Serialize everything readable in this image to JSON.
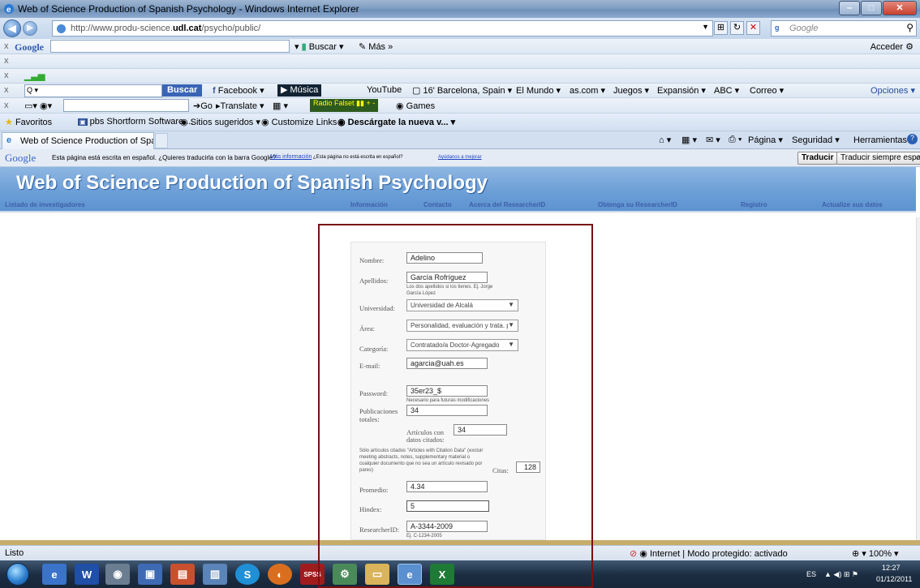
{
  "window": {
    "title": "Web of Science Production of Spanish Psychology - Windows Internet Explorer"
  },
  "address": {
    "url_prefix": "http://www.produ-science.",
    "url_domain": "udl.cat",
    "url_path": "/psycho/public/",
    "search_placeholder": "Google"
  },
  "google_toolbar": {
    "search_btn": "Buscar",
    "mas": "Más",
    "acceder": "Acceder"
  },
  "toolbar2": {
    "buscar": "Buscar",
    "items": [
      "Facebook",
      "Música",
      "YouTube",
      "16' Barcelona, Spain",
      "El Mundo",
      "as.com",
      "Juegos",
      "Expansión",
      "ABC",
      "Correo"
    ],
    "opciones": "Opciones"
  },
  "toolbar3": {
    "go": "Go",
    "translate": "Translate",
    "radio": "Radio Falset",
    "games": "Games"
  },
  "favorites": {
    "label": "Favoritos",
    "items": [
      "pbs Shortform Software ...",
      "Sitios sugeridos",
      "Customize Links",
      "Descárgate la nueva v..."
    ]
  },
  "tab": {
    "title": "Web of Science Production of Spanish..."
  },
  "command": {
    "pagina": "Página",
    "seguridad": "Seguridad",
    "herramientas": "Herramientas"
  },
  "translate_bar": {
    "logo": "Google",
    "message": "Esta página está escrita en español. ¿Quieres traducirla con la barra Google?",
    "link": "Más información",
    "small": "¿Esta página no está escrita en español?",
    "help": "Ayúdanos a mejorar",
    "btn1": "Traducir",
    "btn2": "Traducir siempre español"
  },
  "site": {
    "title": "Web of Science Production of Spanish Psychology",
    "nav": [
      "Listado de investigadores",
      "Información",
      "Contacto",
      "Acerca del ResearcherID",
      "Obtenga su ResearcherID",
      "Registro",
      "Actualize sus datos"
    ]
  },
  "form": {
    "nombre_label": "Nombre:",
    "nombre": "Adelino",
    "apellidos_label": "Apellidos:",
    "apellidos": "García Rofríguez",
    "apellidos_hint": "Los dos apellidos si los tienes. Ej. Jorge García López",
    "universidad_label": "Universidad:",
    "universidad": "Universidad de Alcalá",
    "area_label": "Área:",
    "area": "Personalidad, evaluación y trata. p",
    "categoria_label": "Categoría:",
    "categoria": "Contratado/a Doctor-Agregado",
    "email_label": "E-mail:",
    "email": "agarcia@uah.es",
    "password_label": "Password:",
    "password": "35er23_$",
    "password_hint": "Necesario para futuras modificaciones",
    "publicaciones_label_1": "Publicaciones",
    "publicaciones_label_2": "totales:",
    "publicaciones": "34",
    "articulos_label_1": "Artículos con",
    "articulos_label_2": "datos citados:",
    "articulos": "34",
    "citas_note": "Sólo artículos citados \"Articles with Citation Data\" (excluir meeting abstracts, notes, supplementary material o cualquier documento que no sea un artículo revisado por pares)",
    "citas_label": "Citas:",
    "citas": "128",
    "promedio_label": "Promedio:",
    "promedio": "4.34",
    "hindex_label": "Hindex:",
    "hindex": "5",
    "researcherid_label": "ResearcherID:",
    "researcherid": "A-3344-2009",
    "researcherid_hint": "Ej. C-1234-2005"
  },
  "status": {
    "left": "Listo",
    "zone": "Internet | Modo protegido: activado",
    "zoom": "100%"
  },
  "tray": {
    "lang": "ES",
    "time": "12:27",
    "date": "01/12/2011"
  }
}
